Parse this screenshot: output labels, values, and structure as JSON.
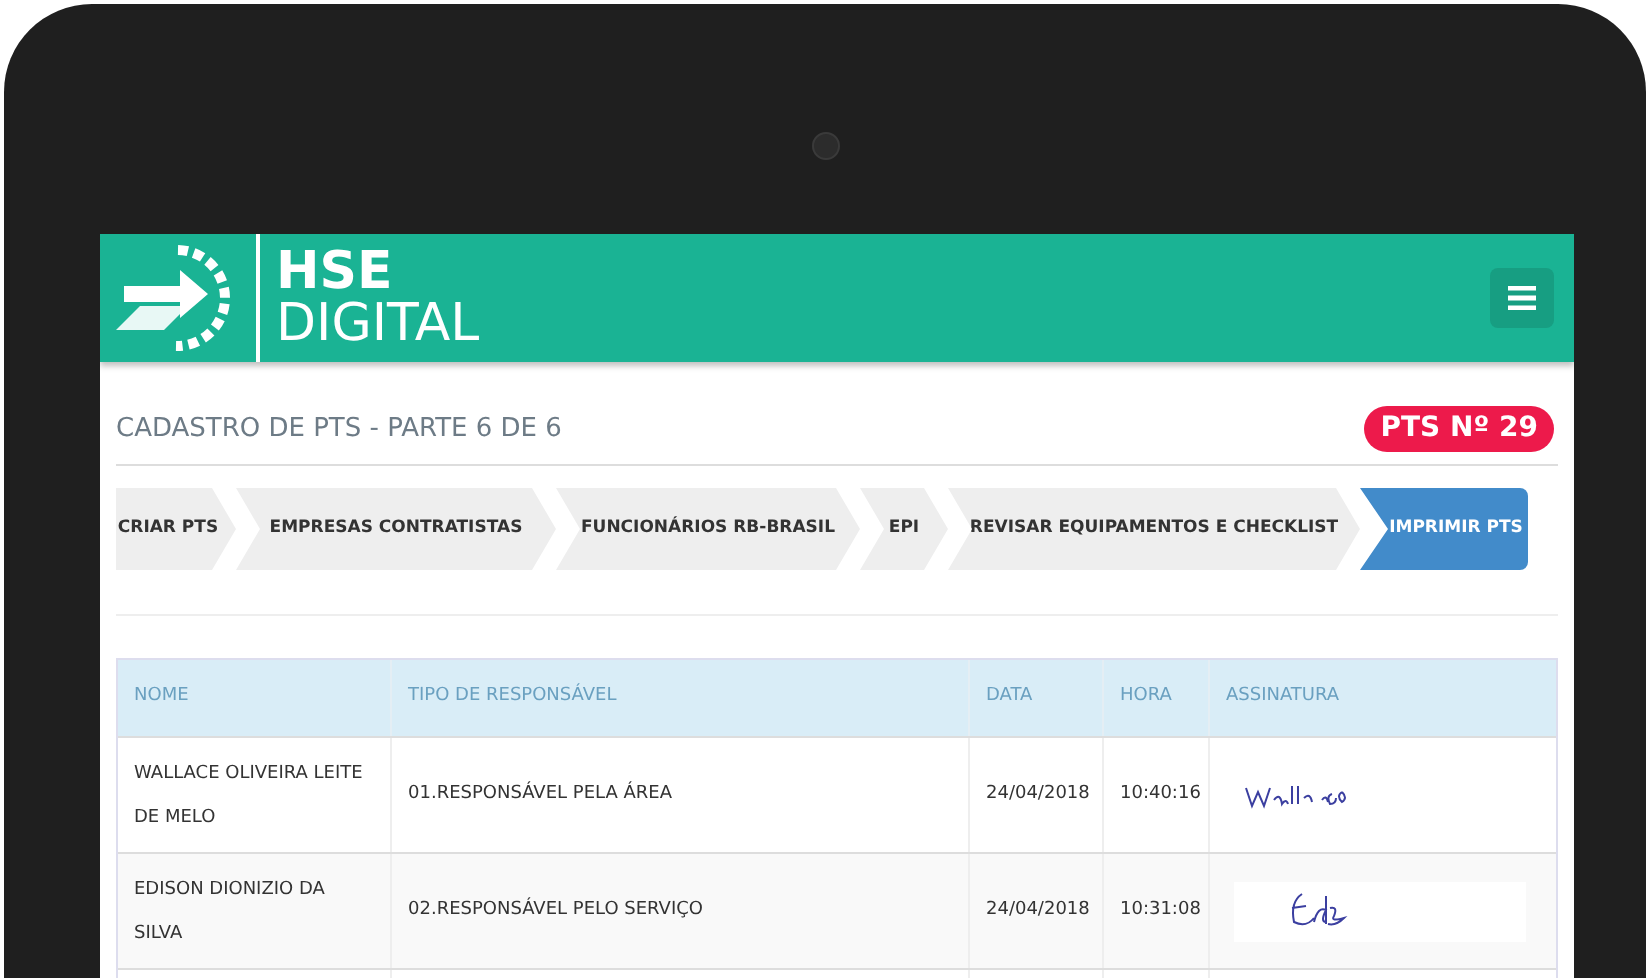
{
  "header": {
    "logo_line1": "HSE",
    "logo_line2": "DIGITAL"
  },
  "page": {
    "title": "CADASTRO DE PTS - PARTE 6 DE 6",
    "badge": "PTS Nº 29"
  },
  "steps": [
    {
      "label": "CRIAR PTS",
      "selected": false
    },
    {
      "label": "EMPRESAS CONTRATISTAS",
      "selected": false
    },
    {
      "label": "FUNCIONÁRIOS RB-BRASIL",
      "selected": false
    },
    {
      "label": "EPI",
      "selected": false
    },
    {
      "label": "REVISAR EQUIPAMENTOS E CHECKLIST",
      "selected": false
    },
    {
      "label": "IMPRIMIR PTS",
      "selected": true
    }
  ],
  "table": {
    "columns": [
      "NOME",
      "TIPO DE RESPONSÁVEL",
      "DATA",
      "HORA",
      "ASSINATURA"
    ],
    "rows": [
      {
        "name": "WALLACE OLIVEIRA LEITE DE MELO",
        "type": "01.RESPONSÁVEL PELA ÁREA",
        "date": "24/04/2018",
        "time": "10:40:16"
      },
      {
        "name": "EDISON DIONIZIO DA SILVA",
        "type": "02.RESPONSÁVEL PELO SERVIÇO",
        "date": "24/04/2018",
        "time": "10:31:08"
      }
    ]
  }
}
